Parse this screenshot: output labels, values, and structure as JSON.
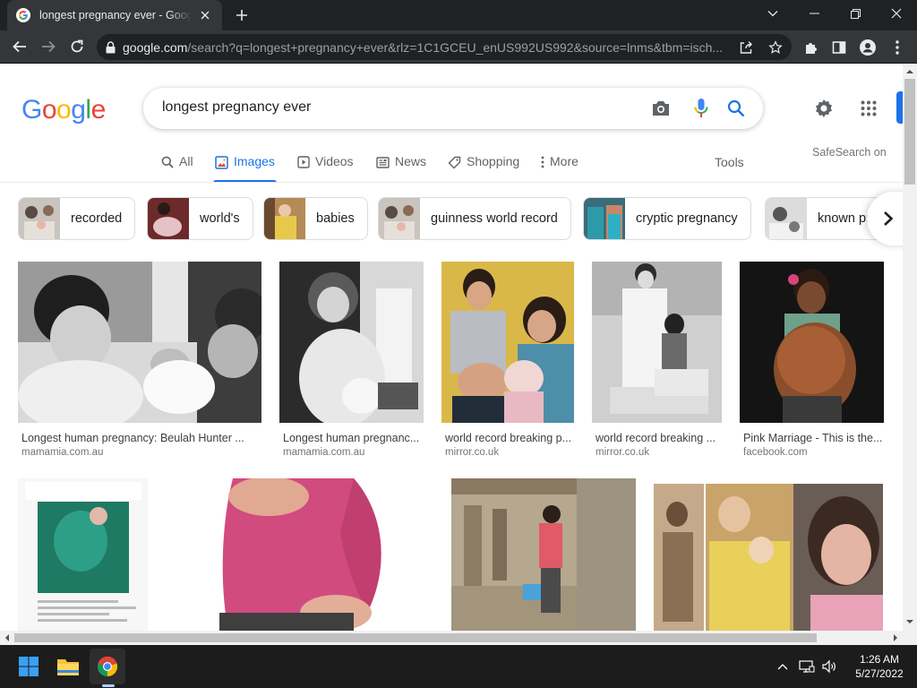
{
  "browser": {
    "tab_title": "longest pregnancy ever - Google Search",
    "url_host": "google.com",
    "url_path": "/search?q=longest+pregnancy+ever&rlz=1C1GCEU_enUS992US992&source=lnms&tbm=isch..."
  },
  "google": {
    "logo_letters": [
      "G",
      "o",
      "o",
      "g",
      "l",
      "e"
    ],
    "logo_colors": [
      "#4285F4",
      "#EA4335",
      "#FBBC05",
      "#4285F4",
      "#34A853",
      "#EA4335"
    ],
    "query": "longest pregnancy ever",
    "tabs": [
      {
        "label": "All",
        "icon": "search-icon",
        "active": false
      },
      {
        "label": "Images",
        "icon": "image-icon",
        "active": true
      },
      {
        "label": "Videos",
        "icon": "play-icon",
        "active": false
      },
      {
        "label": "News",
        "icon": "news-icon",
        "active": false
      },
      {
        "label": "Shopping",
        "icon": "tag-icon",
        "active": false
      },
      {
        "label": "More",
        "icon": "more-vert-icon",
        "active": false
      }
    ],
    "tools_label": "Tools",
    "safesearch_label": "SafeSearch on",
    "chips": [
      "recorded",
      "world's",
      "babies",
      "guinness world record",
      "cryptic pregnancy",
      "known pr"
    ],
    "results_row1": [
      {
        "title": "Longest human pregnancy: Beulah Hunter ...",
        "source": "mamamia.com.au"
      },
      {
        "title": "Longest human pregnanc...",
        "source": "mamamia.com.au"
      },
      {
        "title": "world record breaking p...",
        "source": "mirror.co.uk"
      },
      {
        "title": "world record breaking ...",
        "source": "mirror.co.uk"
      },
      {
        "title": "Pink Marriage - This is the...",
        "source": "facebook.com"
      }
    ]
  },
  "taskbar": {
    "time": "1:26 AM",
    "date": "5/27/2022"
  },
  "colors": {
    "accent": "#1a73e8",
    "chrome_dark": "#202124",
    "chrome_toolbar": "#35363a"
  }
}
